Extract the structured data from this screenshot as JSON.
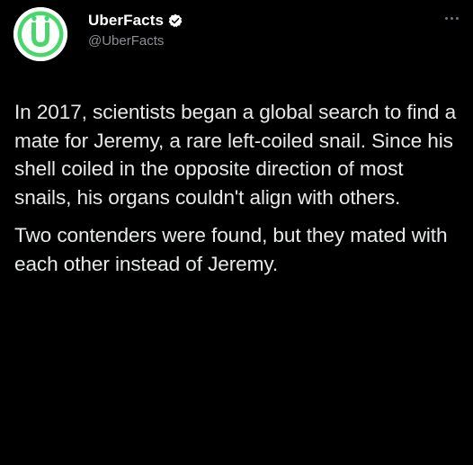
{
  "account": {
    "display_name": "UberFacts",
    "handle": "@UberFacts",
    "avatar_letter": "U",
    "verified": true,
    "avatar_color": "#4ad66d",
    "verified_color": "#ffffff"
  },
  "menu": {
    "icon": "more-dots-icon"
  },
  "tweet": {
    "paragraphs": [
      "In 2017, scientists began a global search to find a mate for Jeremy, a rare left-coiled snail. Since his shell coiled in the opposite direction of most snails, his organs couldn't align with others.",
      "Two contenders were found, but they mated with each other instead of Jeremy."
    ]
  },
  "colors": {
    "background": "#000000",
    "text": "#e7e9ea",
    "secondary_text": "#8b8f94"
  }
}
